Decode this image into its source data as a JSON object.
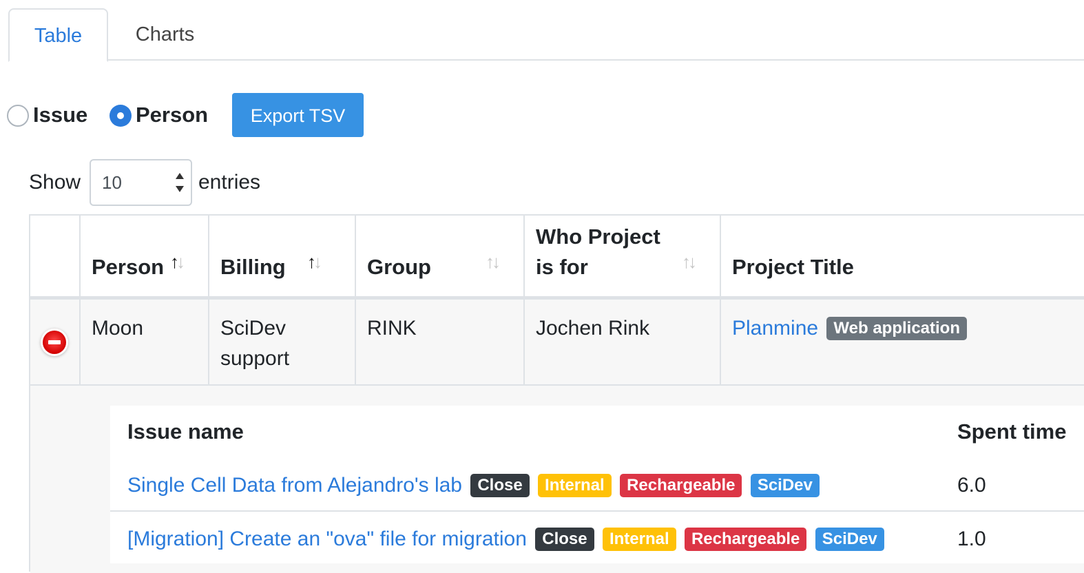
{
  "tabs": [
    {
      "label": "Table",
      "active": true
    },
    {
      "label": "Charts",
      "active": false
    }
  ],
  "view_mode": {
    "options": [
      {
        "label": "Issue",
        "selected": false
      },
      {
        "label": "Person",
        "selected": true
      }
    ],
    "export_label": "Export TSV"
  },
  "page_length": {
    "show_label": "Show",
    "value": "10",
    "entries_label": "entries"
  },
  "table": {
    "columns": [
      {
        "label": "",
        "sort": "none"
      },
      {
        "label": "Person",
        "sort": "asc"
      },
      {
        "label": "Billing",
        "sort": "asc"
      },
      {
        "label": "Group",
        "sort": "none"
      },
      {
        "label": "Who Project is for",
        "sort": "none"
      },
      {
        "label": "Project Title",
        "sort": "none"
      }
    ],
    "rows": [
      {
        "person": "Moon",
        "billing": "SciDev support",
        "group": "RINK",
        "who_for": "Jochen Rink",
        "project_title": "Planmine",
        "project_badge": "Web application",
        "expanded": true
      }
    ]
  },
  "child_table": {
    "columns": {
      "issue_name": "Issue name",
      "spent_time": "Spent time"
    },
    "rows": [
      {
        "issue_name": "Single Cell Data from Alejandro's lab",
        "badges": [
          "Close",
          "Internal",
          "Rechargeable",
          "SciDev"
        ],
        "spent_time": "6.0"
      },
      {
        "issue_name": "[Migration] Create an \"ova\" file for migration",
        "badges": [
          "Close",
          "Internal",
          "Rechargeable",
          "SciDev"
        ],
        "spent_time": "1.0"
      }
    ]
  },
  "colors": {
    "accent": "#2b7bdb",
    "button": "#3792e3",
    "badge_close": "#343a40",
    "badge_internal": "#ffc107",
    "badge_rechargeable": "#dc3545",
    "badge_scidev": "#3792e3",
    "badge_project": "#6c757d"
  }
}
